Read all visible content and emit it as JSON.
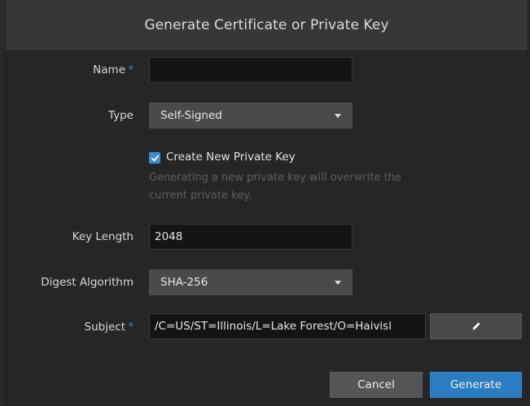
{
  "dialog": {
    "title": "Generate Certificate or Private Key"
  },
  "form": {
    "name": {
      "label": "Name",
      "required_mark": "*",
      "value": ""
    },
    "type": {
      "label": "Type",
      "selected": "Self-Signed"
    },
    "create_key": {
      "label": "Create New Private Key",
      "checked": true,
      "help_line1": "Generating a new private key will overwrite the",
      "help_line2": "current private key."
    },
    "key_length": {
      "label": "Key Length",
      "value": "2048"
    },
    "digest": {
      "label": "Digest Algorithm",
      "selected": "SHA-256"
    },
    "subject": {
      "label": "Subject",
      "required_mark": "*",
      "value": "/C=US/ST=Illinois/L=Lake Forest/O=Haivisl"
    }
  },
  "buttons": {
    "cancel": "Cancel",
    "generate": "Generate"
  },
  "icons": {
    "checkbox": "checkmark-icon",
    "subject_edit": "pencil-icon",
    "select_caret": "caret-down-icon"
  },
  "colors": {
    "accent": "#2b7cc1",
    "required": "#3a8fd0",
    "background": "#262626",
    "header": "#373737"
  }
}
